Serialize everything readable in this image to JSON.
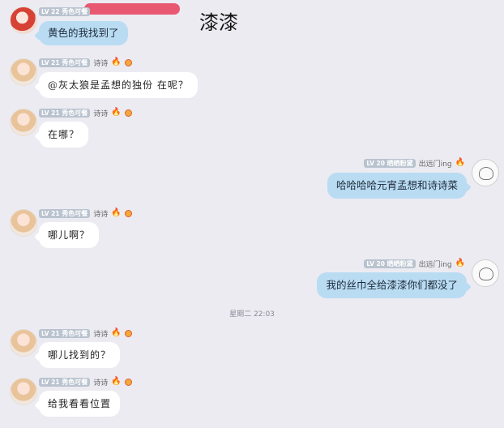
{
  "header": {
    "title": "漆漆"
  },
  "timestamp": "星期二 22:03",
  "messages": [
    {
      "side": "left",
      "level": "LV 22",
      "tag": "秀色可餐",
      "name": "",
      "text": "黄色的我找到了",
      "style": "blue"
    },
    {
      "side": "left",
      "level": "LV 21",
      "tag": "秀色可餐",
      "name": "诗诗",
      "text": "@灰太狼是孟想的独份 在呢？",
      "style": "white"
    },
    {
      "side": "left",
      "level": "LV 21",
      "tag": "秀色可餐",
      "name": "诗诗",
      "text": "在哪？",
      "style": "white"
    },
    {
      "side": "right",
      "level": "LV 20",
      "tag": "晒晒粉黛",
      "name": "出远门ing",
      "text": "哈哈哈哈元宵孟想和诗诗菜",
      "style": "blue"
    },
    {
      "side": "left",
      "level": "LV 21",
      "tag": "秀色可餐",
      "name": "诗诗",
      "text": "哪儿啊？",
      "style": "white"
    },
    {
      "side": "right",
      "level": "LV 20",
      "tag": "晒晒粉黛",
      "name": "出远门ing",
      "text": "我的丝巾全给漆漆你们都没了",
      "style": "blue"
    },
    {
      "side": "left",
      "level": "LV 21",
      "tag": "秀色可餐",
      "name": "诗诗",
      "text": "哪儿找到的？",
      "style": "white"
    },
    {
      "side": "left",
      "level": "LV 21",
      "tag": "秀色可餐",
      "name": "诗诗",
      "text": "给我看看位置",
      "style": "white"
    }
  ]
}
